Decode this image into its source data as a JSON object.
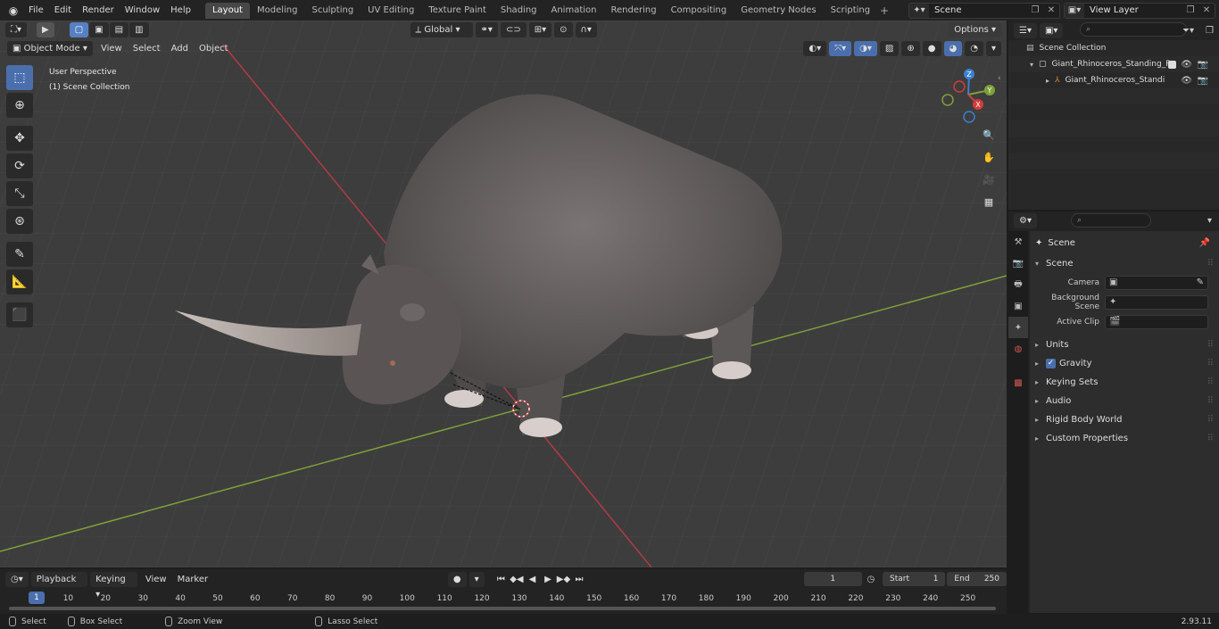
{
  "menu": [
    "File",
    "Edit",
    "Render",
    "Window",
    "Help"
  ],
  "workspaces": [
    "Layout",
    "Modeling",
    "Sculpting",
    "UV Editing",
    "Texture Paint",
    "Shading",
    "Animation",
    "Rendering",
    "Compositing",
    "Geometry Nodes",
    "Scripting"
  ],
  "active_workspace": "Layout",
  "scene_name": "Scene",
  "view_layer": "View Layer",
  "viewport": {
    "mode": "Object Mode",
    "menus": [
      "View",
      "Select",
      "Add",
      "Object"
    ],
    "transform_orientation": "Global",
    "options_label": "Options",
    "view_label": "User Perspective",
    "collection_label": "(1) Scene Collection"
  },
  "gizmo": {
    "x": "X",
    "y": "Y",
    "z": "Z"
  },
  "outliner": {
    "root": "Scene Collection",
    "items": [
      "Giant_Rhinoceros_Standing_P",
      "Giant_Rhinoceros_Standi"
    ]
  },
  "properties": {
    "context": "Scene",
    "panel_title": "Scene",
    "fields": [
      {
        "label": "Camera"
      },
      {
        "label": "Background Scene"
      },
      {
        "label": "Active Clip"
      }
    ],
    "panels": [
      "Units",
      "Gravity",
      "Keying Sets",
      "Audio",
      "Rigid Body World",
      "Custom Properties"
    ]
  },
  "timeline": {
    "menus": [
      "Playback",
      "Keying",
      "View",
      "Marker"
    ],
    "current_frame": "1",
    "start_label": "Start",
    "start": "1",
    "end_label": "End",
    "end": "250",
    "ticks": [
      "1",
      "10",
      "20",
      "30",
      "40",
      "50",
      "60",
      "70",
      "80",
      "90",
      "100",
      "110",
      "120",
      "130",
      "140",
      "150",
      "160",
      "170",
      "180",
      "190",
      "200",
      "210",
      "220",
      "230",
      "240",
      "250"
    ]
  },
  "status": {
    "select": "Select",
    "box_select": "Box Select",
    "zoom_view": "Zoom View",
    "lasso_select": "Lasso Select",
    "version": "2.93.11"
  }
}
